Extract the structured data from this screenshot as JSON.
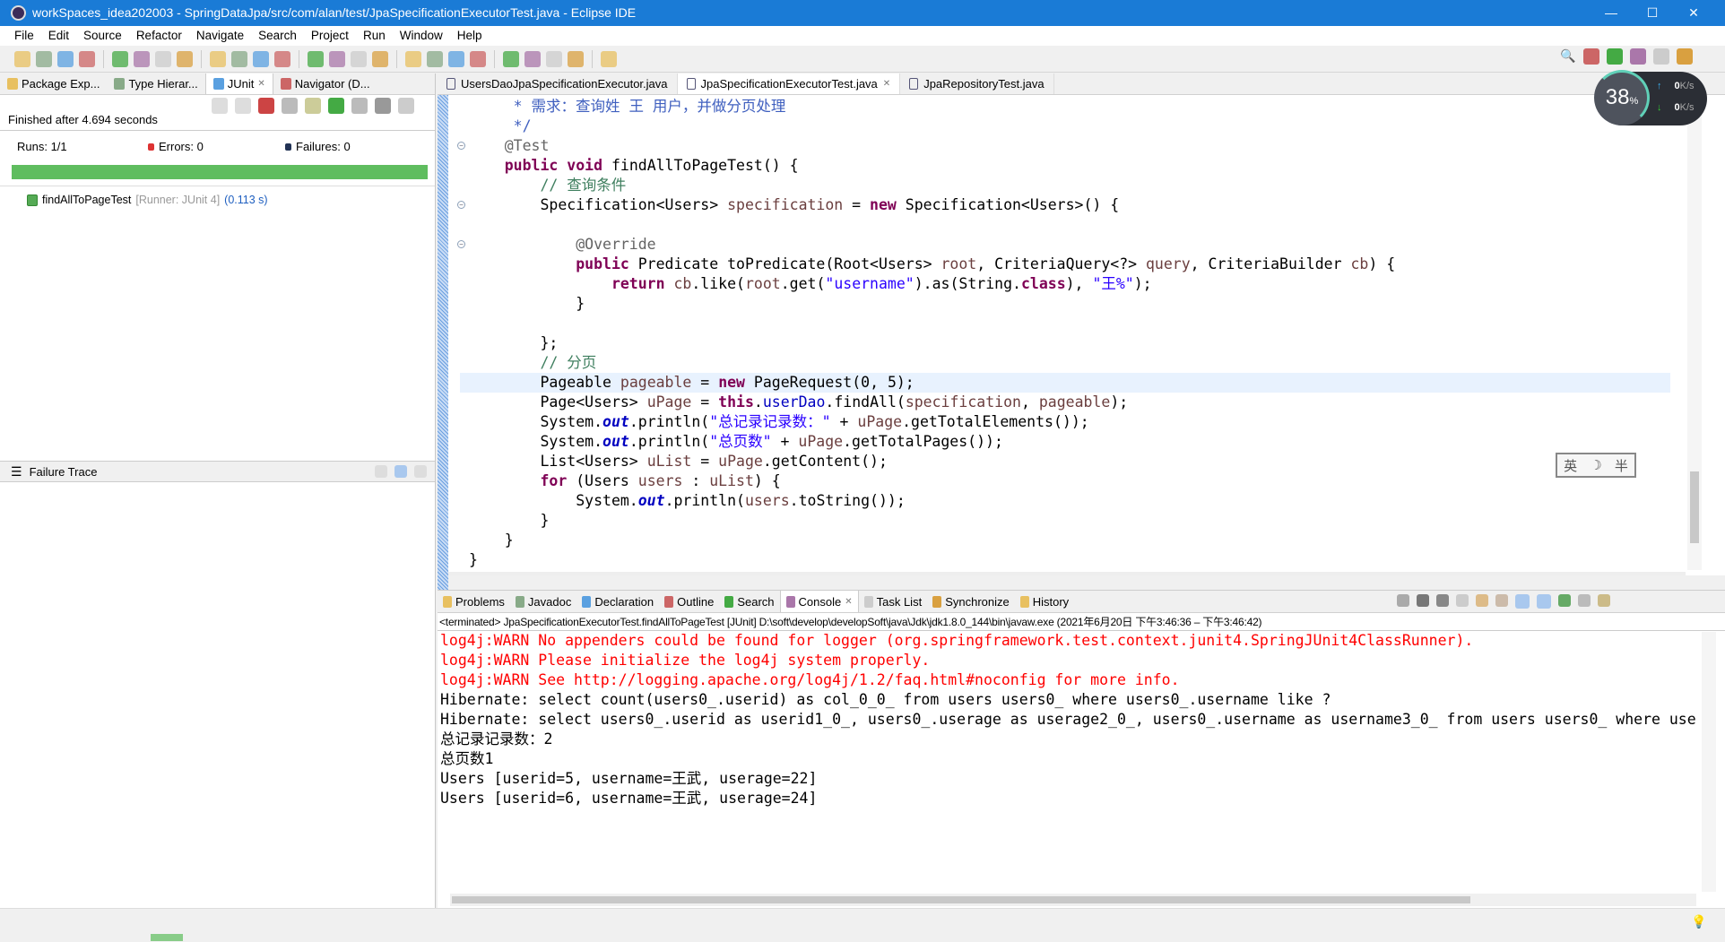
{
  "window": {
    "title": "workSpaces_idea202003 - SpringDataJpa/src/com/alan/test/JpaSpecificationExecutorTest.java - Eclipse IDE",
    "minimize": "—",
    "maximize": "☐",
    "close": "✕",
    "accent": "#1a7bd6"
  },
  "menu": [
    "File",
    "Edit",
    "Source",
    "Refactor",
    "Navigate",
    "Search",
    "Project",
    "Run",
    "Window",
    "Help"
  ],
  "toolbar_icons": [
    "new-icon",
    "save-icon",
    "save-all-icon",
    "terminal-icon",
    "skip-breakpoints-icon",
    "new-java-package-icon",
    "new-class-icon",
    "debug-icon",
    "run-icon",
    "run-coverage-icon",
    "external-tools-icon",
    "open-type-icon",
    "open-task-icon",
    "search-tool-icon",
    "toggle-mark-icon",
    "annotation-icon",
    "block-selection-icon",
    "whitespace-icon",
    "show-whitespace-icon",
    "next-annotation-icon",
    "prev-annotation-icon",
    "last-edit-icon",
    "back-icon",
    "forward-icon",
    "pin-editor-icon"
  ],
  "perspective_icons": [
    "search-icon",
    "open-perspective-icon",
    "java-ee-icon",
    "java-icon",
    "database-icon",
    "debug-perspective-icon"
  ],
  "left": {
    "tabs": [
      "Package Exp...",
      "Type Hierar...",
      "JUnit",
      "Navigator (D..."
    ],
    "finished": "Finished after 4.694 seconds",
    "runs": "Runs:  1/1",
    "errors": "Errors:  0",
    "failures": "Failures:  0",
    "progress_percent": 100,
    "bar_color": "#5fbd5f",
    "test": {
      "name": "findAllToPageTest",
      "runner": "[Runner: JUnit 4]",
      "time": "(0.113 s)"
    },
    "failure_trace": "Failure Trace"
  },
  "editor": {
    "tabs": [
      "UsersDaoJpaSpecificationExecutor.java",
      "JpaSpecificationExecutorTest.java",
      "JpaRepositoryTest.java"
    ],
    "active_tab": 1,
    "highlight_line": 14,
    "fold_lines": [
      2,
      5,
      7
    ],
    "lines": [
      [
        [
          "j",
          "     * 需求：查询姓 王 用户，并做分页处理"
        ]
      ],
      [
        [
          "j",
          "     */"
        ]
      ],
      [
        [
          "a",
          "    @Test"
        ]
      ],
      [
        [
          "k",
          "    public void "
        ],
        [
          "t",
          "findAllToPageTest() {"
        ]
      ],
      [
        [
          "c",
          "        // 查询条件"
        ]
      ],
      [
        [
          "t",
          "        Specification<Users> "
        ],
        [
          "v",
          "specification"
        ],
        [
          "t",
          " = "
        ],
        [
          "k",
          "new"
        ],
        [
          "t",
          " Specification<Users>() {"
        ]
      ],
      [
        [
          "t",
          ""
        ]
      ],
      [
        [
          "a",
          "            @Override"
        ]
      ],
      [
        [
          "k",
          "            public"
        ],
        [
          "t",
          " Predicate toPredicate(Root<Users> "
        ],
        [
          "v",
          "root"
        ],
        [
          "t",
          ", CriteriaQuery<?> "
        ],
        [
          "v",
          "query"
        ],
        [
          "t",
          ", CriteriaBuilder "
        ],
        [
          "v",
          "cb"
        ],
        [
          "t",
          ") {"
        ]
      ],
      [
        [
          "k",
          "                return "
        ],
        [
          "v",
          "cb"
        ],
        [
          "t",
          ".like("
        ],
        [
          "v",
          "root"
        ],
        [
          "t",
          ".get("
        ],
        [
          "s",
          "\"username\""
        ],
        [
          "t",
          ").as(String."
        ],
        [
          "k",
          "class"
        ],
        [
          "t",
          "), "
        ],
        [
          "s",
          "\"王%\""
        ],
        [
          "t",
          ");"
        ]
      ],
      [
        [
          "t",
          "            }"
        ]
      ],
      [
        [
          "t",
          ""
        ]
      ],
      [
        [
          "t",
          "        };"
        ]
      ],
      [
        [
          "c",
          "        // 分页"
        ]
      ],
      [
        [
          "t",
          "        Pageable "
        ],
        [
          "v",
          "pageable"
        ],
        [
          "t",
          " = "
        ],
        [
          "k",
          "new"
        ],
        [
          "t",
          " PageRequest(0, 5);"
        ]
      ],
      [
        [
          "t",
          "        Page<Users> "
        ],
        [
          "v",
          "uPage"
        ],
        [
          "t",
          " = "
        ],
        [
          "k",
          "this"
        ],
        [
          "t",
          "."
        ],
        [
          "f",
          "userDao"
        ],
        [
          "t",
          ".findAll("
        ],
        [
          "v",
          "specification"
        ],
        [
          "t",
          ", "
        ],
        [
          "v",
          "pageable"
        ],
        [
          "t",
          ");"
        ]
      ],
      [
        [
          "t",
          "        System."
        ],
        [
          "o",
          "out"
        ],
        [
          "t",
          ".println("
        ],
        [
          "s",
          "\"总记录记录数：\""
        ],
        [
          "t",
          " + "
        ],
        [
          "v",
          "uPage"
        ],
        [
          "t",
          ".getTotalElements());"
        ]
      ],
      [
        [
          "t",
          "        System."
        ],
        [
          "o",
          "out"
        ],
        [
          "t",
          ".println("
        ],
        [
          "s",
          "\"总页数\""
        ],
        [
          "t",
          " + "
        ],
        [
          "v",
          "uPage"
        ],
        [
          "t",
          ".getTotalPages());"
        ]
      ],
      [
        [
          "t",
          "        List<Users> "
        ],
        [
          "v",
          "uList"
        ],
        [
          "t",
          " = "
        ],
        [
          "v",
          "uPage"
        ],
        [
          "t",
          ".getContent();"
        ]
      ],
      [
        [
          "k",
          "        for"
        ],
        [
          "t",
          " (Users "
        ],
        [
          "v",
          "users"
        ],
        [
          "t",
          " : "
        ],
        [
          "v",
          "uList"
        ],
        [
          "t",
          ") {"
        ]
      ],
      [
        [
          "t",
          "            System."
        ],
        [
          "o",
          "out"
        ],
        [
          "t",
          ".println("
        ],
        [
          "v",
          "users"
        ],
        [
          "t",
          ".toString());"
        ]
      ],
      [
        [
          "t",
          "        }"
        ]
      ],
      [
        [
          "t",
          "    }"
        ]
      ],
      [
        [
          "t",
          "}"
        ]
      ]
    ]
  },
  "netwidget": {
    "cpu": "38",
    "cpu_unit": "%",
    "up": "0",
    "down": "0",
    "unit": "K/s"
  },
  "ime": [
    "英",
    "☽",
    "半"
  ],
  "console": {
    "tabs": [
      "Problems",
      "Javadoc",
      "Declaration",
      "Outline",
      "Search",
      "Console",
      "Task List",
      "Synchronize",
      "History"
    ],
    "active_tab": 5,
    "header": "<terminated> JpaSpecificationExecutorTest.findAllToPageTest [JUnit] D:\\soft\\develop\\developSoft\\java\\Jdk\\jdk1.8.0_144\\bin\\javaw.exe  (2021年6月20日 下午3:46:36 – 下午3:46:42)",
    "lines": [
      {
        "text": "log4j:WARN No appenders could be found for logger (org.springframework.test.context.junit4.SpringJUnit4ClassRunner).",
        "color": "#ff0000"
      },
      {
        "text": "log4j:WARN Please initialize the log4j system properly.",
        "color": "#ff0000"
      },
      {
        "text": "log4j:WARN See http://logging.apache.org/log4j/1.2/faq.html#noconfig for more info.",
        "color": "#ff0000"
      },
      {
        "text": "Hibernate: select count(users0_.userid) as col_0_0_ from users users0_ where users0_.username like ?",
        "color": "#000000"
      },
      {
        "text": "Hibernate: select users0_.userid as userid1_0_, users0_.userage as userage2_0_, users0_.username as username3_0_ from users users0_ where use",
        "color": "#000000"
      },
      {
        "text": "总记录记录数：2",
        "color": "#000000"
      },
      {
        "text": "总页数1",
        "color": "#000000"
      },
      {
        "text": "Users [userid=5, username=王武, userage=22]",
        "color": "#000000"
      },
      {
        "text": "Users [userid=6, username=王武, userage=24]",
        "color": "#000000"
      }
    ]
  }
}
